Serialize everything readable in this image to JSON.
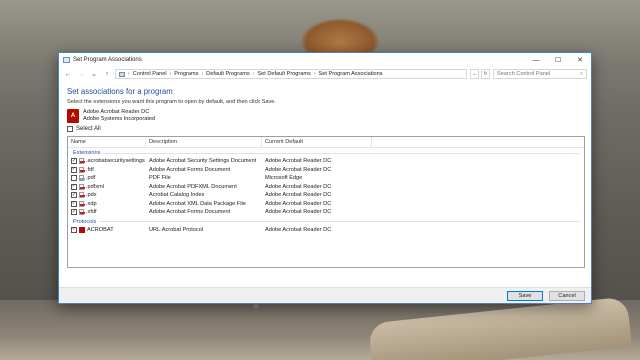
{
  "window": {
    "title": "Set Program Associations"
  },
  "address": {
    "breadcrumbs": [
      "Control Panel",
      "Programs",
      "Default Programs",
      "Set Default Programs",
      "Set Program Associations"
    ],
    "search_placeholder": "Search Control Panel"
  },
  "main": {
    "heading": "Set associations for a program",
    "instructions": "Select the extensions you want this program to open by default, and then click Save.",
    "program": {
      "name": "Adobe Acrobat Reader DC",
      "publisher": "Adobe Systems Incorporated"
    },
    "select_all_label": "Select All"
  },
  "list": {
    "columns": [
      "Name",
      "Description",
      "Current Default"
    ],
    "groups": {
      "extensions_label": "Extensions",
      "protocols_label": "Protocols"
    },
    "extensions": [
      {
        "name": ".acrobatsecuritysettings",
        "description": "Adobe Acrobat Security Settings Document",
        "current": "Adobe Acrobat Reader DC",
        "checked": true
      },
      {
        "name": ".fdf",
        "description": "Adobe Acrobat Forms Document",
        "current": "Adobe Acrobat Reader DC",
        "checked": true
      },
      {
        "name": ".pdf",
        "description": "PDF File",
        "current": "Microsoft Edge",
        "checked": false
      },
      {
        "name": ".pdfxml",
        "description": "Adobe Acrobat PDFXML Document",
        "current": "Adobe Acrobat Reader DC",
        "checked": true
      },
      {
        "name": ".pdx",
        "description": "Acrobat Catalog Index",
        "current": "Adobe Acrobat Reader DC",
        "checked": true
      },
      {
        "name": ".xdp",
        "description": "Adobe Acrobat XML Data Package File",
        "current": "Adobe Acrobat Reader DC",
        "checked": true
      },
      {
        "name": ".xfdf",
        "description": "Adobe Acrobat Forms Document",
        "current": "Adobe Acrobat Reader DC",
        "checked": true
      }
    ],
    "protocols": [
      {
        "name": "ACROBAT",
        "description": "URL:Acrobat Protocol",
        "current": "Adobe Acrobat Reader DC",
        "checked": true
      }
    ]
  },
  "footer": {
    "save_label": "Save",
    "cancel_label": "Cancel"
  }
}
